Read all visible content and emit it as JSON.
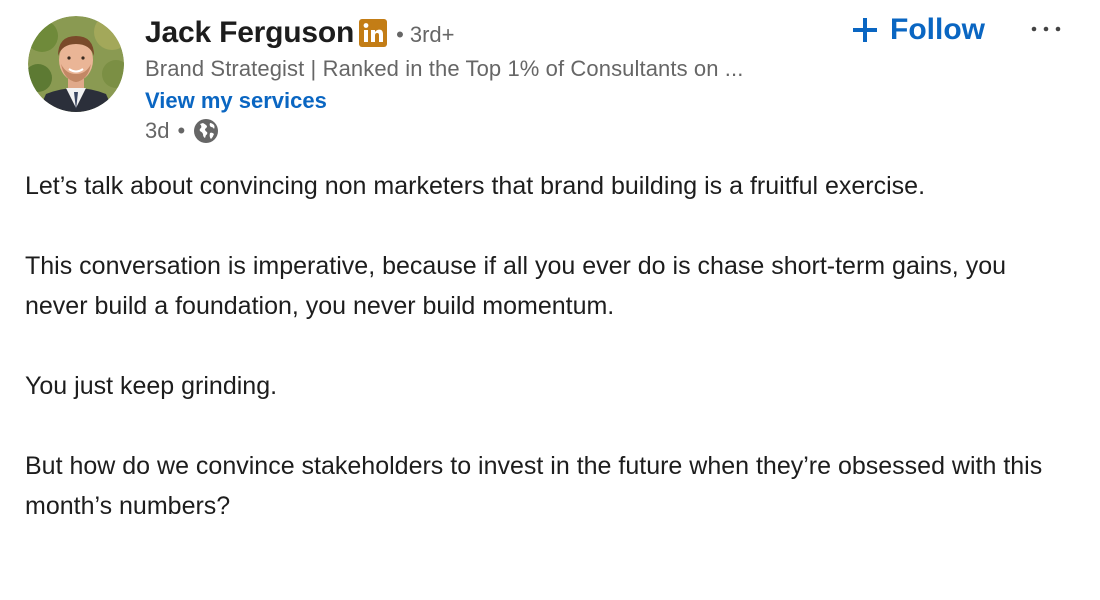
{
  "author": {
    "name": "Jack Ferguson",
    "badge_icon": "linkedin-premium-icon",
    "badge_color": "#c37d16",
    "connection_degree": "3rd+",
    "headline": "Brand Strategist | Ranked in the Top 1% of Consultants on ...",
    "services_link": "View my services"
  },
  "meta": {
    "time_ago": "3d",
    "visibility_icon": "globe-icon"
  },
  "actions": {
    "follow_label": "Follow",
    "follow_icon": "plus-icon",
    "more_icon": "more-options-icon"
  },
  "colors": {
    "link_blue": "#0a66c2",
    "secondary_text": "#666666",
    "primary_text": "#1d1d1d"
  },
  "post": {
    "paragraphs": [
      "Let’s talk about convincing non marketers that brand building is a fruitful exercise.",
      "This conversation is imperative, because if all you ever do is chase short-term gains, you never build a foundation, you never build momentum.",
      "You just keep grinding.",
      "But how do we convince stakeholders to invest in the future when they’re obsessed with this month’s numbers?"
    ]
  }
}
